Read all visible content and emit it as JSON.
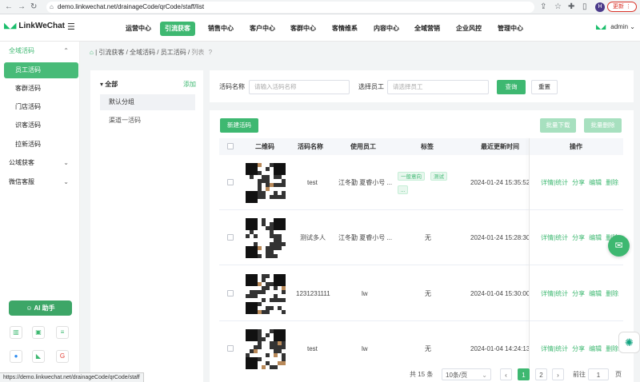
{
  "browser": {
    "url": "demo.linkwechat.net/drainageCode/qrCode/staff/list",
    "update_label": "更新",
    "avatar": "H"
  },
  "header": {
    "logo": "LinkWeChat",
    "nav": [
      "运营中心",
      "引流获客",
      "销售中心",
      "客户中心",
      "客群中心",
      "客情维系",
      "内容中心",
      "全域营销",
      "企业风控",
      "管理中心"
    ],
    "active_nav": "引流获客",
    "user": "admin"
  },
  "sidebar": {
    "group1": "全域活码",
    "items": [
      "员工活码",
      "客群活码",
      "门店活码",
      "识客活码",
      "拉新活码"
    ],
    "group2": "公域获客",
    "group3": "微信客服",
    "ai_button": "AI 助手"
  },
  "breadcrumb": [
    "引流获客",
    "全域活码",
    "员工活码",
    "列表"
  ],
  "groups": {
    "title": "全部",
    "add": "添加",
    "items": [
      "默认分组",
      "渠道一活码"
    ]
  },
  "filter": {
    "name_label": "活码名称",
    "name_placeholder": "请输入活码名称",
    "staff_label": "选择员工",
    "staff_placeholder": "请选择员工",
    "query": "查询",
    "reset": "重置"
  },
  "table": {
    "new_button": "新建活码",
    "batch_download": "批量下载",
    "batch_delete": "批量删除",
    "headers": [
      "二维码",
      "活码名称",
      "使用员工",
      "标签",
      "最近更新时间",
      "操作"
    ],
    "rows": [
      {
        "name": "test",
        "staff": "江冬勤 夏睿小号 ...",
        "tags": [
          "一般意向",
          "测试",
          "..."
        ],
        "time": "2024-01-24 15:35:52"
      },
      {
        "name": "测试多人",
        "staff": "江冬勤 夏睿小号 ...",
        "tags_text": "无",
        "time": "2024-01-24 15:28:30"
      },
      {
        "name": "1231231111",
        "staff": "lw",
        "tags_text": "无",
        "time": "2024-01-04 15:30:00"
      },
      {
        "name": "test",
        "staff": "lw",
        "tags_text": "无",
        "time": "2024-01-04 14:24:13"
      }
    ],
    "ops": [
      "详情|统计",
      "分享",
      "编辑",
      "删除"
    ]
  },
  "pagination": {
    "total": "共 15 条",
    "page_size": "10条/页",
    "pages": [
      "1",
      "2"
    ],
    "current": "1",
    "goto": "前往",
    "goto_value": "1",
    "page_suffix": "页"
  },
  "status_url": "https://demo.linkwechat.net/drainageCode/qrCode/staff"
}
